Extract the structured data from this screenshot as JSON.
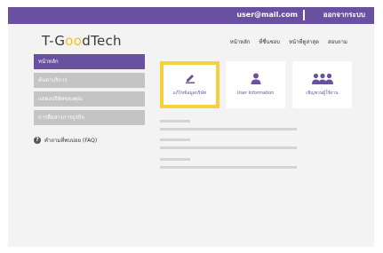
{
  "header": {
    "email": "user@mail.com",
    "logout": "ออกจากระบบ"
  },
  "logo": {
    "prefix": "T-G",
    "o1": "o",
    "o2": "o",
    "suffix": "dTech"
  },
  "nav": {
    "items": [
      "หน้าหลัก",
      "ที่ชื่นชอบ",
      "หน้าที่ดูล่าสุด",
      "สอบถาม"
    ]
  },
  "sidebar": {
    "items": [
      {
        "label": "หน้าหลัก"
      },
      {
        "label": "ค้นหาบริการ"
      },
      {
        "label": "แสดงบริษัทของคุณ"
      },
      {
        "label": "การสื่อสารการธุรกิจ"
      }
    ],
    "faq": "คำถามที่พบบ่อย (FAQ)"
  },
  "cards": [
    {
      "label": "แก้ไขข้อมูลบริษัท",
      "icon": "edit-icon"
    },
    {
      "label": "User Information",
      "icon": "user-icon"
    },
    {
      "label": "เชิญชวนผู้ใช้งาน",
      "icon": "users-group-icon"
    }
  ],
  "colors": {
    "accent": "#6a50a0",
    "highlight": "#f4d23c",
    "sidebar_inactive": "#c4c4c4",
    "logo_o": "#f2c31a"
  }
}
